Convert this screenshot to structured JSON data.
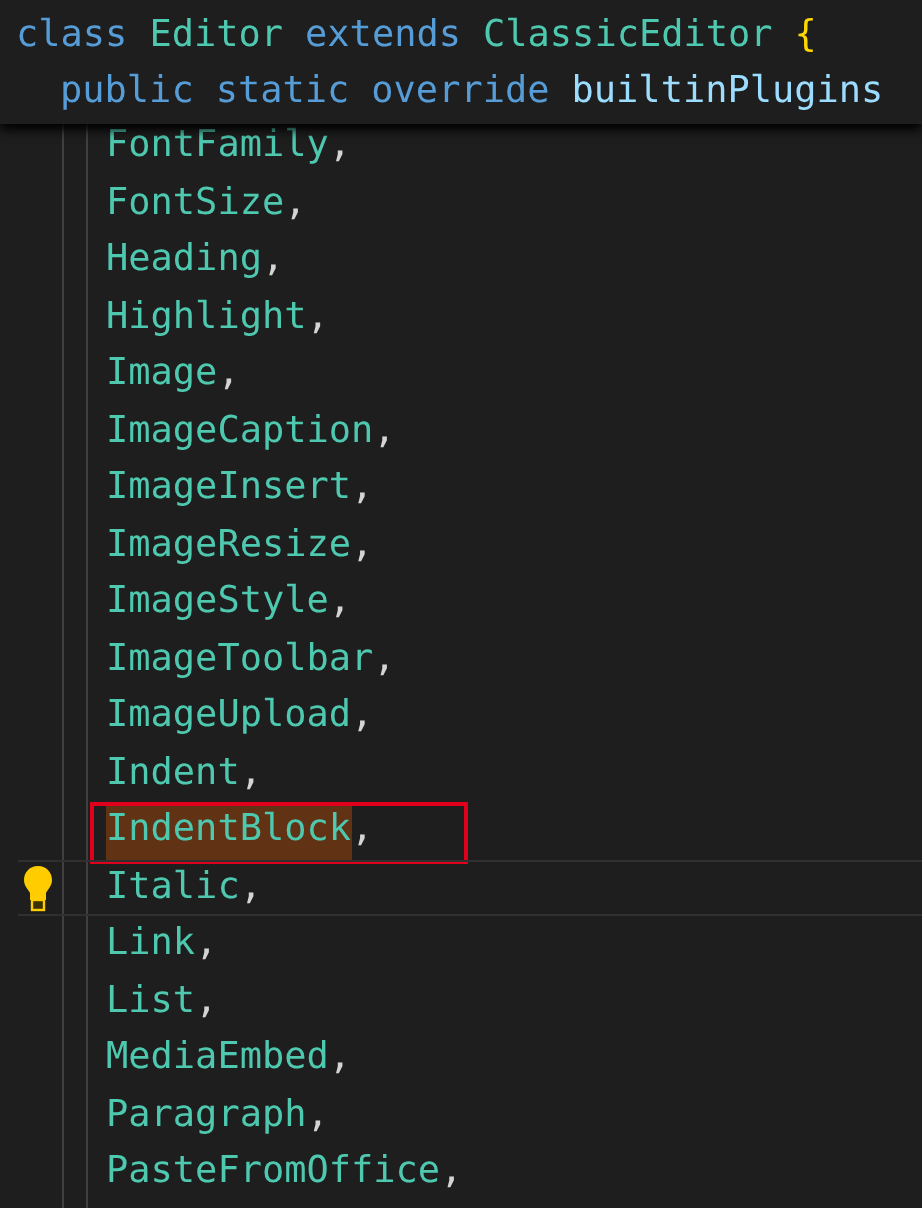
{
  "sticky_scroll": [
    {
      "tokens": [
        {
          "text": "class",
          "kind": "keyword"
        },
        {
          "text": "Editor",
          "kind": "type"
        },
        {
          "text": "extends",
          "kind": "keyword"
        },
        {
          "text": "ClassicEditor",
          "kind": "type"
        },
        {
          "text": "{",
          "kind": "brace"
        }
      ]
    },
    {
      "tokens": [
        {
          "text": "public",
          "kind": "keyword"
        },
        {
          "text": "static",
          "kind": "keyword"
        },
        {
          "text": "override",
          "kind": "keyword"
        },
        {
          "text": "builtinPlugins",
          "kind": "property"
        }
      ]
    }
  ],
  "lines": [
    {
      "name": "FontFamily",
      "punct": ",",
      "highlighted": false,
      "current": false,
      "boxed": false
    },
    {
      "name": "FontSize",
      "punct": ",",
      "highlighted": false,
      "current": false,
      "boxed": false
    },
    {
      "name": "Heading",
      "punct": ",",
      "highlighted": false,
      "current": false,
      "boxed": false
    },
    {
      "name": "Highlight",
      "punct": ",",
      "highlighted": false,
      "current": false,
      "boxed": false
    },
    {
      "name": "Image",
      "punct": ",",
      "highlighted": false,
      "current": false,
      "boxed": false
    },
    {
      "name": "ImageCaption",
      "punct": ",",
      "highlighted": false,
      "current": false,
      "boxed": false
    },
    {
      "name": "ImageInsert",
      "punct": ",",
      "highlighted": false,
      "current": false,
      "boxed": false
    },
    {
      "name": "ImageResize",
      "punct": ",",
      "highlighted": false,
      "current": false,
      "boxed": false
    },
    {
      "name": "ImageStyle",
      "punct": ",",
      "highlighted": false,
      "current": false,
      "boxed": false
    },
    {
      "name": "ImageToolbar",
      "punct": ",",
      "highlighted": false,
      "current": false,
      "boxed": false
    },
    {
      "name": "ImageUpload",
      "punct": ",",
      "highlighted": false,
      "current": false,
      "boxed": false
    },
    {
      "name": "Indent",
      "punct": ",",
      "highlighted": false,
      "current": false,
      "boxed": false
    },
    {
      "name": "IndentBlock",
      "punct": ",",
      "highlighted": true,
      "current": false,
      "boxed": true
    },
    {
      "name": "Italic",
      "punct": ",",
      "highlighted": false,
      "current": true,
      "boxed": false
    },
    {
      "name": "Link",
      "punct": ",",
      "highlighted": false,
      "current": false,
      "boxed": false
    },
    {
      "name": "List",
      "punct": ",",
      "highlighted": false,
      "current": false,
      "boxed": false
    },
    {
      "name": "MediaEmbed",
      "punct": ",",
      "highlighted": false,
      "current": false,
      "boxed": false
    },
    {
      "name": "Paragraph",
      "punct": ",",
      "highlighted": false,
      "current": false,
      "boxed": false
    },
    {
      "name": "PasteFromOffice",
      "punct": ",",
      "highlighted": false,
      "current": false,
      "boxed": false
    }
  ]
}
